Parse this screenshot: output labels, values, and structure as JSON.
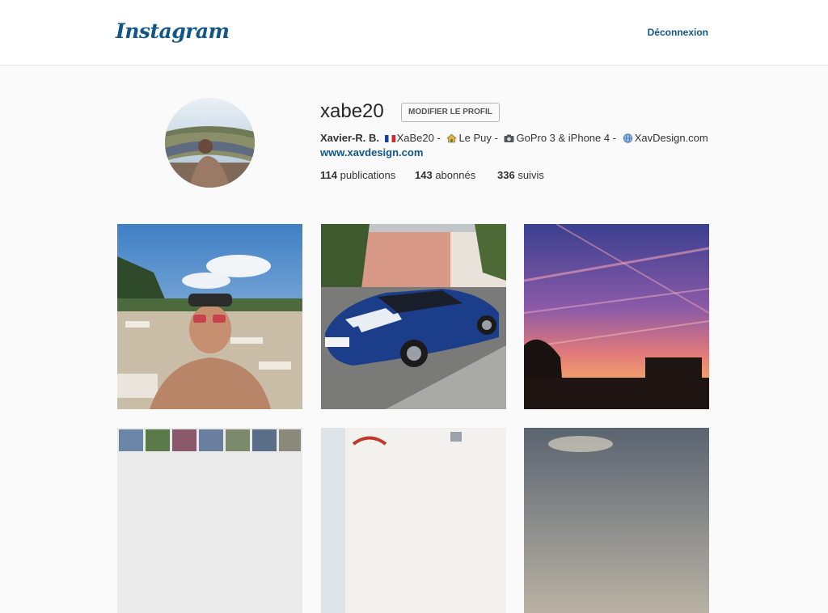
{
  "header": {
    "logo": "Instagram",
    "logout_label": "Déconnexion"
  },
  "profile": {
    "username": "xabe20",
    "edit_button": "MODIFIER LE PROFIL",
    "full_name": "Xavier-R. B.",
    "bio_parts": [
      "XaBe20 -",
      "Le Puy -",
      "GoPro 3 & iPhone 4 -",
      "XavDesign.com"
    ],
    "bio_icons": [
      "flag-france-icon",
      "house-icon",
      "camera-icon",
      "globe-icon"
    ],
    "website": "www.xavdesign.com",
    "stats": {
      "posts_count": "114",
      "posts_label": "publications",
      "followers_count": "143",
      "followers_label": "abonnés",
      "following_count": "336",
      "following_label": "suivis"
    }
  },
  "colors": {
    "brand": "#125688",
    "background": "#fafafa"
  }
}
